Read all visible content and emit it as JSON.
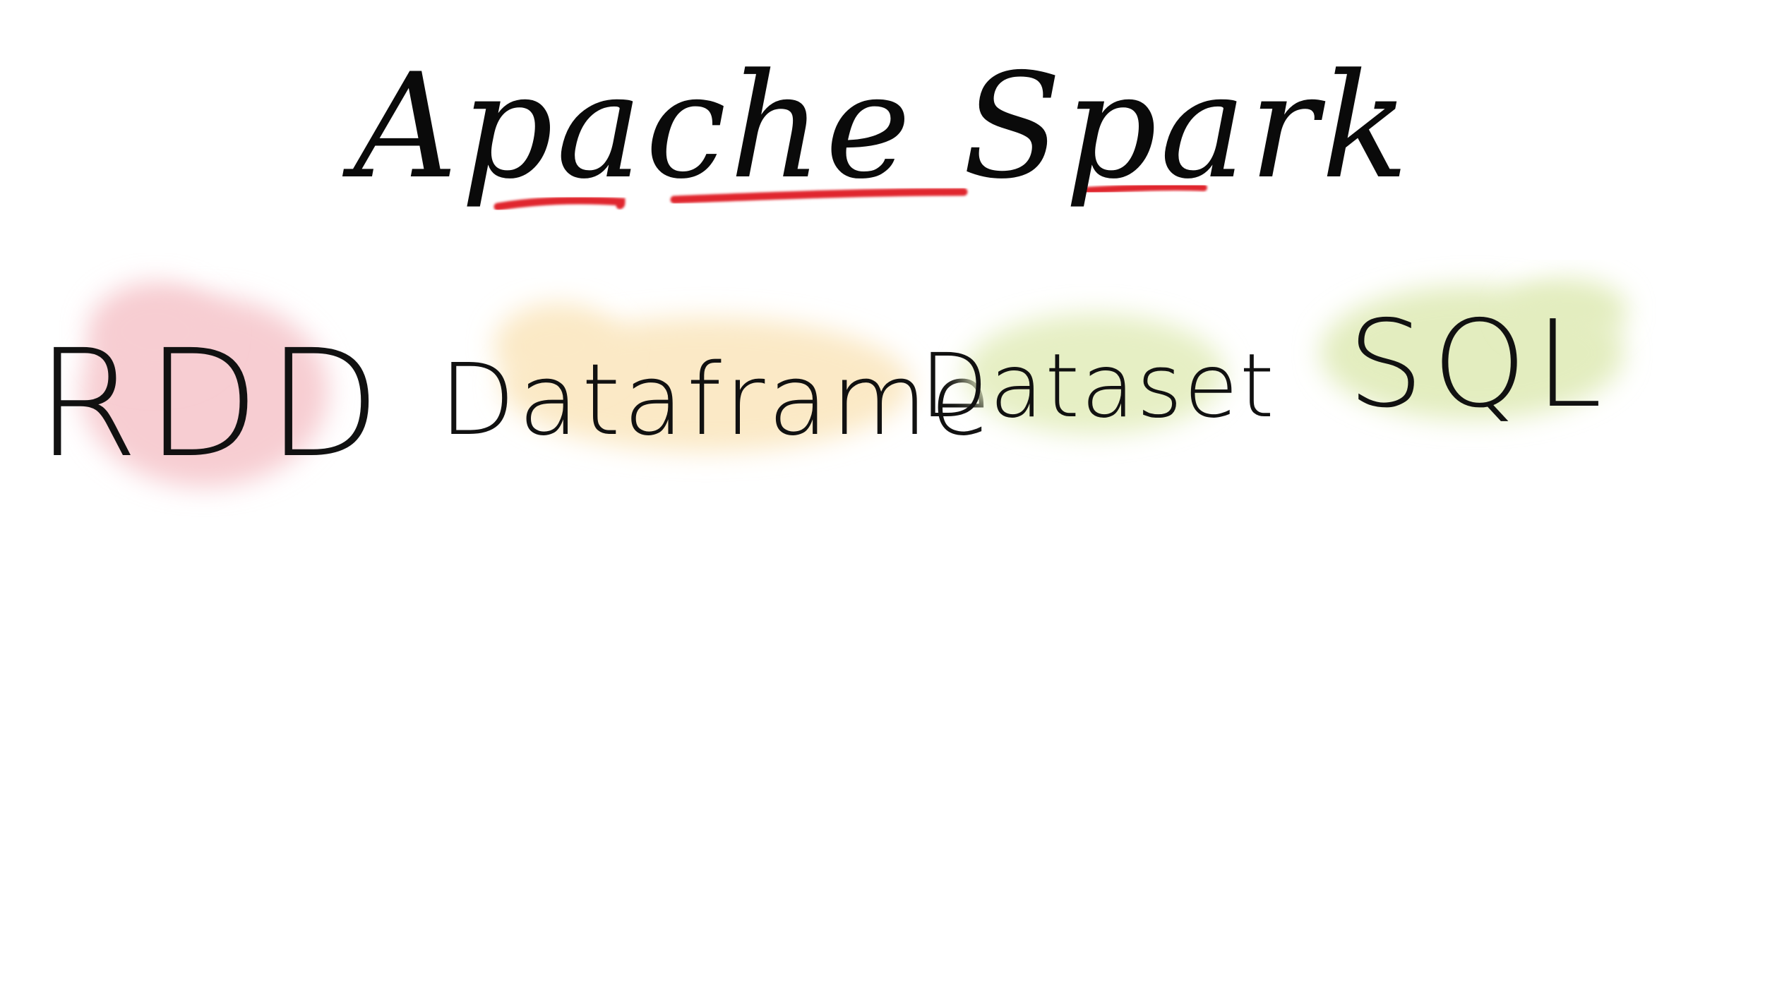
{
  "title": {
    "text": "Apache Spark",
    "underline_color": "#e0262f",
    "ink_color": "#0a0a0a"
  },
  "items": [
    {
      "label": "RDD",
      "highlight_color": "#f7cdd2"
    },
    {
      "label": "Dataframe",
      "highlight_color": "#fbe9c6"
    },
    {
      "label": "Dataset",
      "highlight_color": "#e6efc4"
    },
    {
      "label": "SQL",
      "highlight_color": "#e3edbf"
    }
  ]
}
